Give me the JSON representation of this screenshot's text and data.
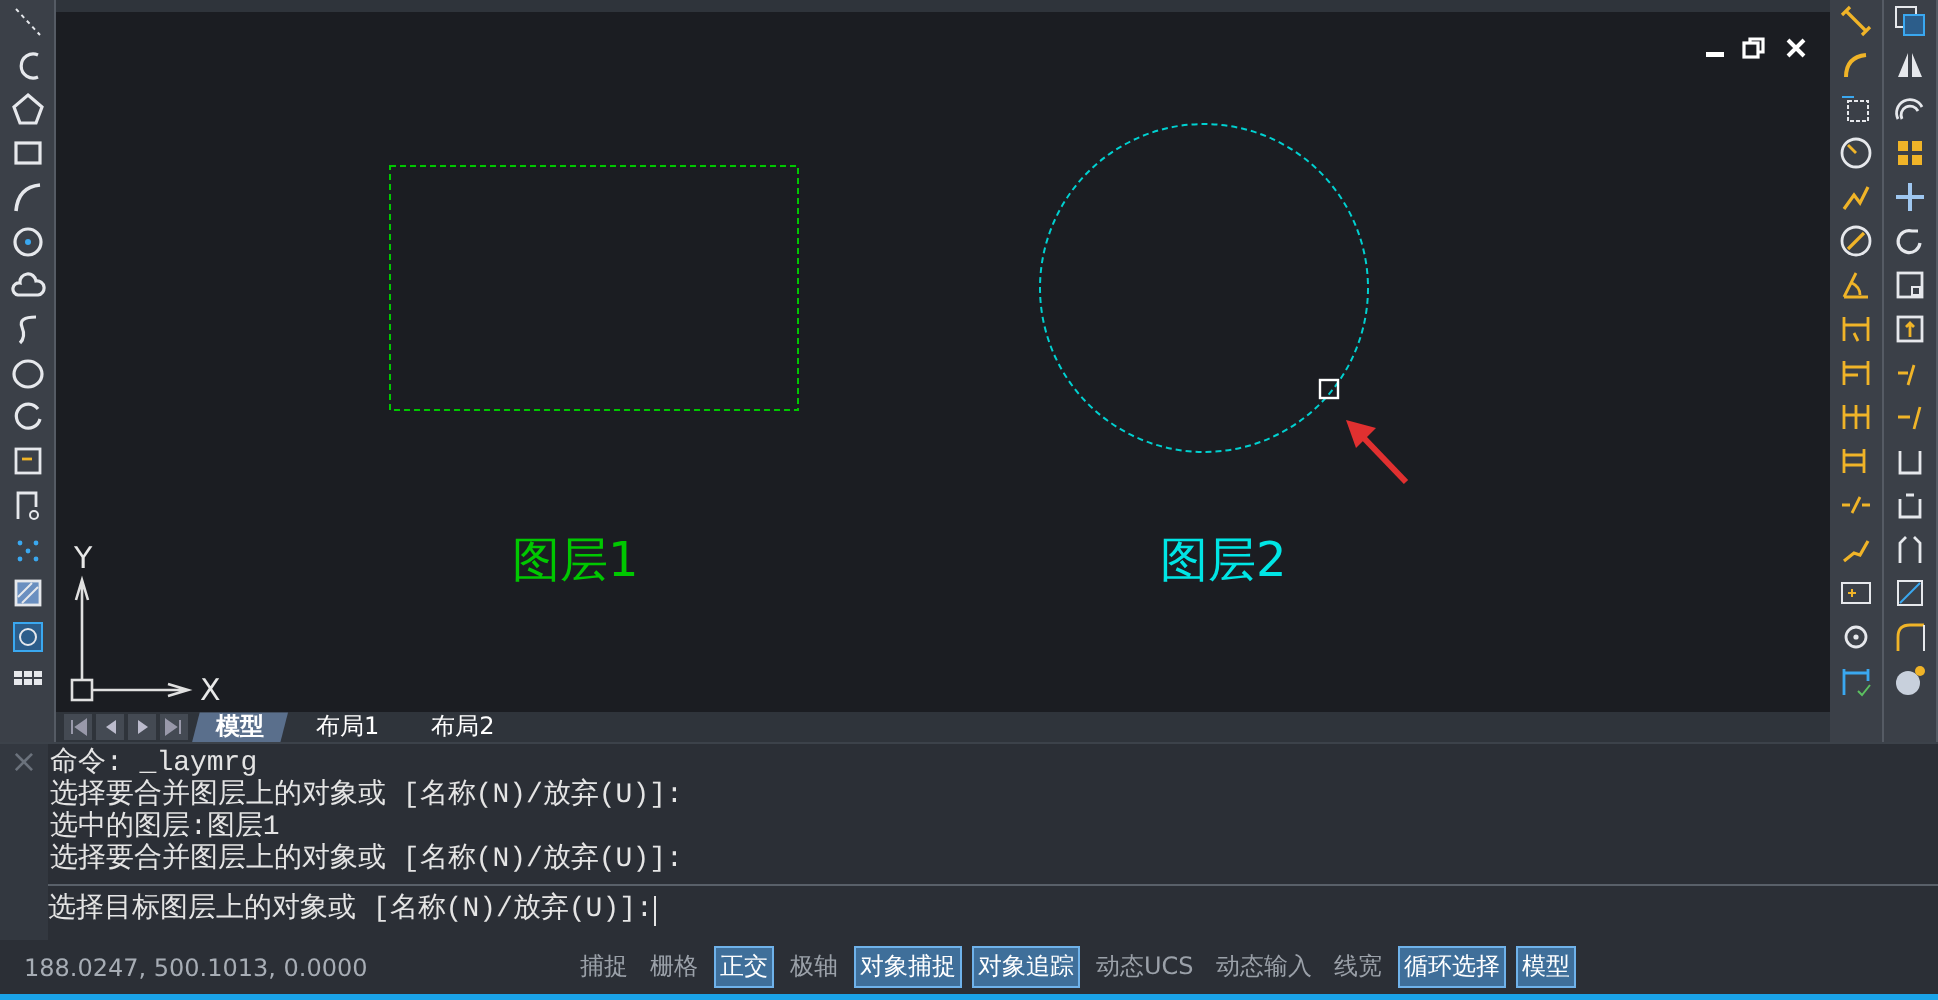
{
  "canvas": {
    "labels": [
      {
        "text": "图层1",
        "color": "#00c800"
      },
      {
        "text": "图层2",
        "color": "#00e5e5"
      }
    ],
    "axis_labels": {
      "x": "X",
      "y": "Y"
    }
  },
  "layout_tabs": [
    {
      "label": "模型",
      "selected": true
    },
    {
      "label": "布局1",
      "selected": false
    },
    {
      "label": "布局2",
      "selected": false
    }
  ],
  "command": {
    "close": "×",
    "history": [
      "命令: _laymrg",
      "选择要合并图层上的对象或 [名称(N)/放弃(U)]:",
      "选中的图层:图层1",
      "选择要合并图层上的对象或 [名称(N)/放弃(U)]:"
    ],
    "prompt": "选择目标图层上的对象或 [名称(N)/放弃(U)]:"
  },
  "status_bar": {
    "coordinates": "188.0247, 500.1013, 0.0000",
    "toggles": [
      {
        "label": "捕捉",
        "on": false
      },
      {
        "label": "栅格",
        "on": false
      },
      {
        "label": "正交",
        "on": true
      },
      {
        "label": "极轴",
        "on": false
      },
      {
        "label": "对象捕捉",
        "on": true
      },
      {
        "label": "对象追踪",
        "on": true
      },
      {
        "label": "动态UCS",
        "on": false
      },
      {
        "label": "动态输入",
        "on": false
      },
      {
        "label": "线宽",
        "on": false
      },
      {
        "label": "循环选择",
        "on": true
      },
      {
        "label": "模型",
        "on": true
      }
    ]
  }
}
